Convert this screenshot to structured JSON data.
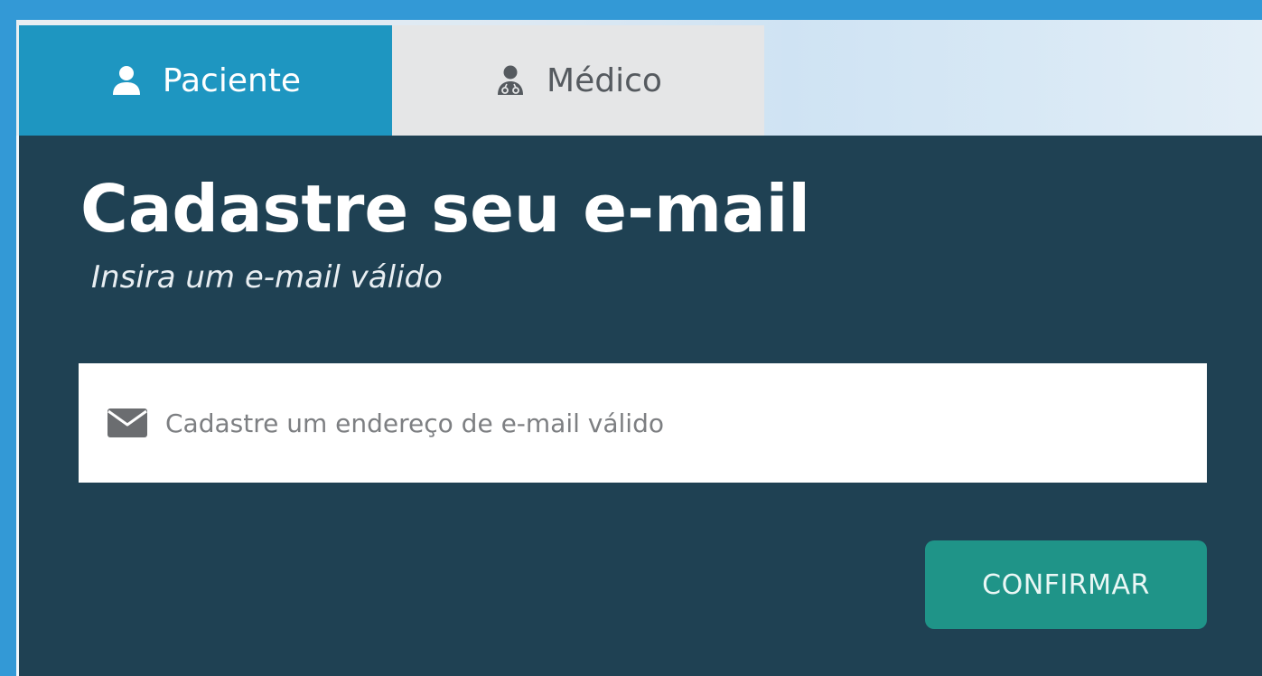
{
  "tabs": [
    {
      "label": "Paciente",
      "icon": "user-icon",
      "active": true
    },
    {
      "label": "Médico",
      "icon": "doctor-icon",
      "active": false
    }
  ],
  "form": {
    "title": "Cadastre seu e-mail",
    "subtitle": "Insira um e-mail válido",
    "email": {
      "icon": "envelope-icon",
      "value": "",
      "placeholder": "Cadastre um endereço de e-mail válido"
    },
    "confirm_label": "CONFIRMAR"
  },
  "colors": {
    "outer_background": "#3399d6",
    "active_tab": "#1e96c1",
    "inactive_tab": "#e5e6e7",
    "panel": "#1f4153",
    "confirm_button": "#1f9488"
  }
}
